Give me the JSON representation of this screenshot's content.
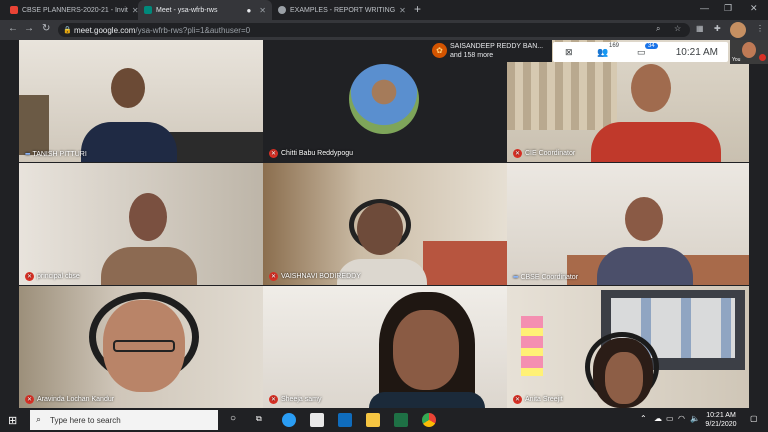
{
  "browser": {
    "tabs": [
      {
        "title": "CBSE PLANNERS-2020-21 - Invit",
        "fav_color": "#ea4335"
      },
      {
        "title": "Meet - ysa-wfrb-rws",
        "fav_color": "#00897b"
      },
      {
        "title": "EXAMPLES - REPORT WRITING",
        "fav_color": "#9aa0a6"
      }
    ],
    "url_host": "meet.google.com",
    "url_path": "/ysa-wfrb-rws?pli=1&authuser=0"
  },
  "meet": {
    "notification": {
      "line1": "SAISANDEEP REDDY BAN...",
      "line2": "and 158 more"
    },
    "people_count": "169",
    "chat_count": "34",
    "time": "10:21 AM",
    "self_label": "You",
    "participants": [
      {
        "name": "TANISH PITTURI",
        "muted": false
      },
      {
        "name": "Chitti Babu Reddypogu",
        "muted": true
      },
      {
        "name": "CIE Coordinator",
        "muted": true
      },
      {
        "name": "principal cbse",
        "muted": true
      },
      {
        "name": "VAISHNAVI BODIREDDY",
        "muted": true
      },
      {
        "name": "CBSE Coordinator",
        "muted": false
      },
      {
        "name": "Aravinda Lochan Kandur",
        "muted": true
      },
      {
        "name": "Sheeja samy",
        "muted": true
      },
      {
        "name": "Anita Sreejit",
        "muted": true
      }
    ]
  },
  "taskbar": {
    "search_placeholder": "Type here to search",
    "clock_time": "10:21 AM",
    "clock_date": "9/21/2020"
  }
}
